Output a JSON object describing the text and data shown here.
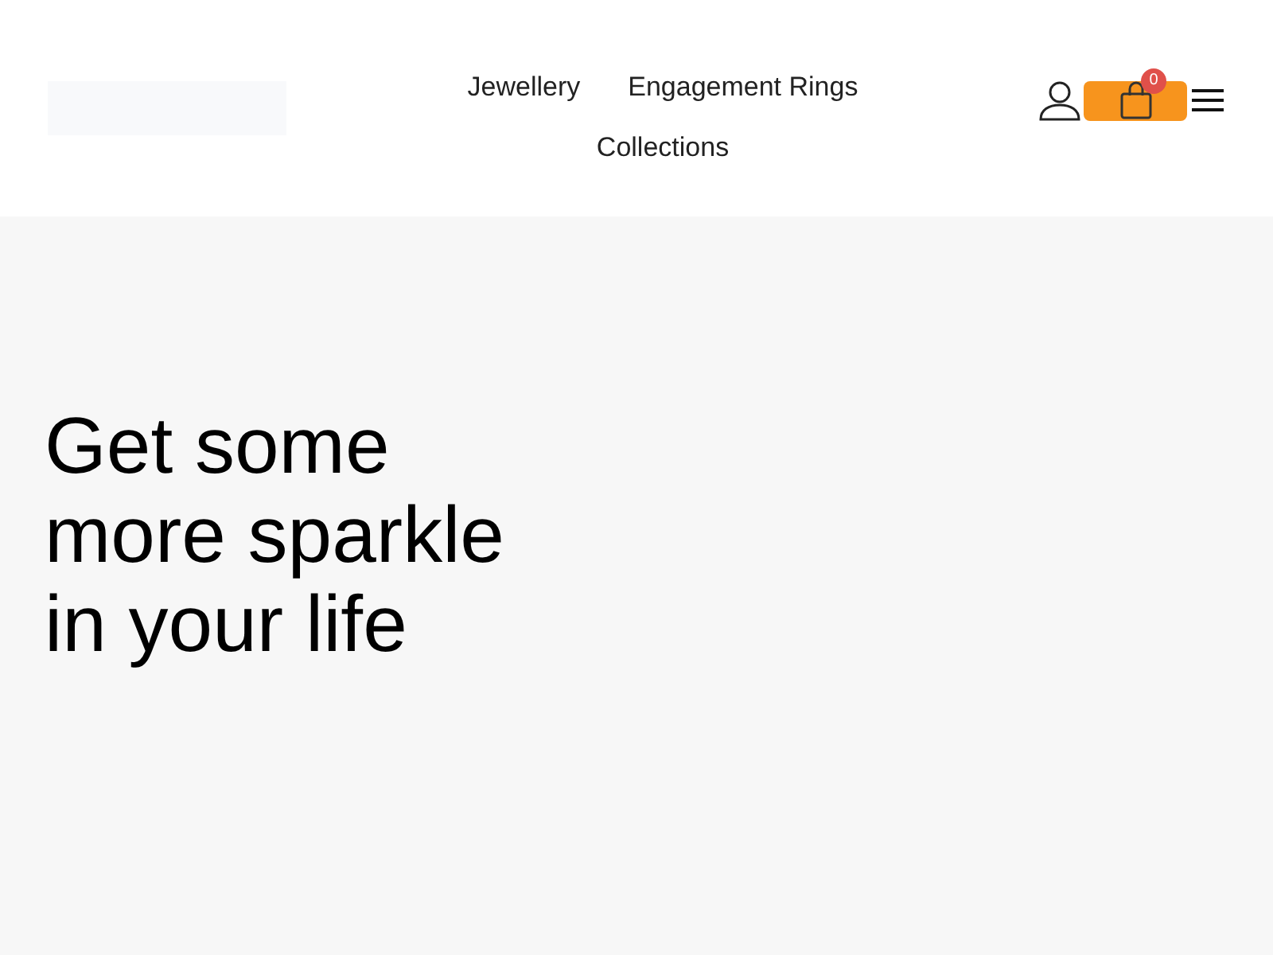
{
  "nav": {
    "items": [
      {
        "label": "Jewellery"
      },
      {
        "label": "Engagement Rings"
      },
      {
        "label": "Collections"
      }
    ]
  },
  "cart": {
    "count": "0"
  },
  "hero": {
    "heading": "Get some more sparkle in your life"
  }
}
